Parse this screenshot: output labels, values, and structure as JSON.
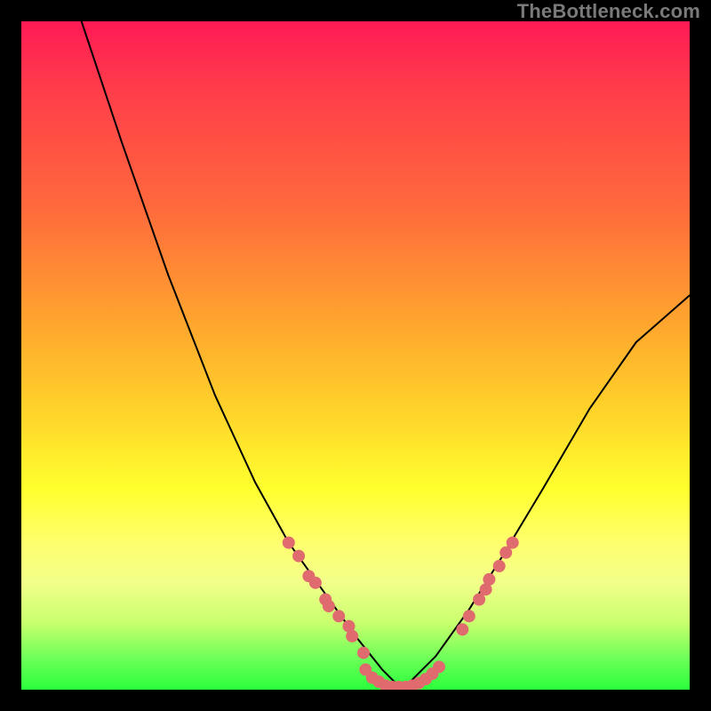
{
  "watermark": "TheBottleneck.com",
  "colors": {
    "frame": "#000000",
    "curve": "#000000",
    "dots": "#e06b6e",
    "gradient_stops": [
      "#ff1a55",
      "#ff3c4a",
      "#ff6a3c",
      "#ffa52e",
      "#ffd22a",
      "#ffff2e",
      "#ffff6e",
      "#f2ff8a",
      "#c9ff6e",
      "#72ff5a",
      "#2aff3c"
    ]
  },
  "chart_data": {
    "type": "line",
    "title": "",
    "xlabel": "",
    "ylabel": "",
    "ylim": [
      0,
      100
    ],
    "xlim": [
      0,
      100
    ],
    "annotations": [],
    "series": [
      {
        "name": "left-curve",
        "comment": "Falls from top-left into the valley bottom",
        "x": [
          9,
          15,
          22,
          29,
          35,
          40,
          45,
          50,
          54,
          57
        ],
        "y": [
          100,
          82,
          62,
          44,
          31,
          22,
          15,
          8,
          3,
          0
        ]
      },
      {
        "name": "right-curve",
        "comment": "Rises from valley bottom toward right, slight easing near end",
        "x": [
          57,
          62,
          67,
          72,
          78,
          85,
          92,
          100
        ],
        "y": [
          0,
          5,
          12,
          20,
          30,
          42,
          52,
          59
        ]
      }
    ],
    "dot_clusters": [
      {
        "name": "left-descent-dots",
        "comment": "Scattered pink dots along lower-left slope",
        "points": [
          {
            "x": 40,
            "y": 22
          },
          {
            "x": 41.5,
            "y": 20
          },
          {
            "x": 43,
            "y": 17
          },
          {
            "x": 44,
            "y": 16
          },
          {
            "x": 45.5,
            "y": 13.5
          },
          {
            "x": 46,
            "y": 12.5
          },
          {
            "x": 47.5,
            "y": 11
          },
          {
            "x": 49,
            "y": 9.5
          },
          {
            "x": 49.5,
            "y": 8
          },
          {
            "x": 51.2,
            "y": 5.5
          }
        ]
      },
      {
        "name": "valley-dots",
        "comment": "Cluster across flat valley bottom",
        "points": [
          {
            "x": 51.5,
            "y": 3
          },
          {
            "x": 52.5,
            "y": 1.8
          },
          {
            "x": 53.5,
            "y": 1.2
          },
          {
            "x": 54.5,
            "y": 0.6
          },
          {
            "x": 55.5,
            "y": 0.4
          },
          {
            "x": 56.5,
            "y": 0.4
          },
          {
            "x": 57.5,
            "y": 0.4
          },
          {
            "x": 58.5,
            "y": 0.6
          },
          {
            "x": 59.5,
            "y": 1.0
          },
          {
            "x": 60.5,
            "y": 1.6
          },
          {
            "x": 61.5,
            "y": 2.4
          },
          {
            "x": 62.5,
            "y": 3.4
          }
        ]
      },
      {
        "name": "right-ascent-dots",
        "comment": "Scattered pink dots along lower-right slope",
        "points": [
          {
            "x": 66,
            "y": 9
          },
          {
            "x": 67,
            "y": 11
          },
          {
            "x": 68.5,
            "y": 13.5
          },
          {
            "x": 69.5,
            "y": 15
          },
          {
            "x": 70,
            "y": 16.5
          },
          {
            "x": 71.5,
            "y": 18.5
          },
          {
            "x": 72.5,
            "y": 20.5
          },
          {
            "x": 73.5,
            "y": 22
          }
        ]
      }
    ]
  }
}
